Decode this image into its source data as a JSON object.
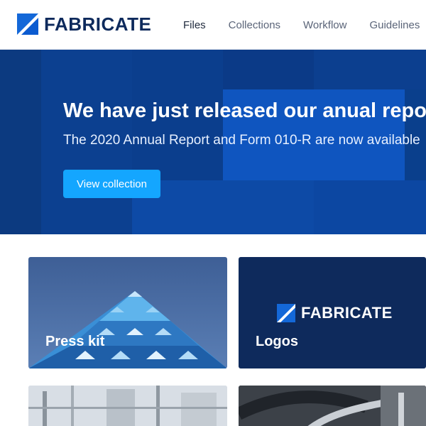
{
  "brand": {
    "name": "FABRICATE"
  },
  "nav": {
    "items": [
      {
        "label": "Files"
      },
      {
        "label": "Collections"
      },
      {
        "label": "Workflow"
      },
      {
        "label": "Guidelines"
      }
    ]
  },
  "hero": {
    "title": "We have just released our anual report",
    "subtitle": "The 2020 Annual Report and Form 010-R are now available",
    "button_label": "View collection"
  },
  "cards": [
    {
      "label": "Press kit"
    },
    {
      "label": "Logos"
    }
  ],
  "colors": {
    "brand_navy": "#0e2a5c",
    "accent_blue": "#14a6ff",
    "hero_blue": "#0a3f91"
  }
}
